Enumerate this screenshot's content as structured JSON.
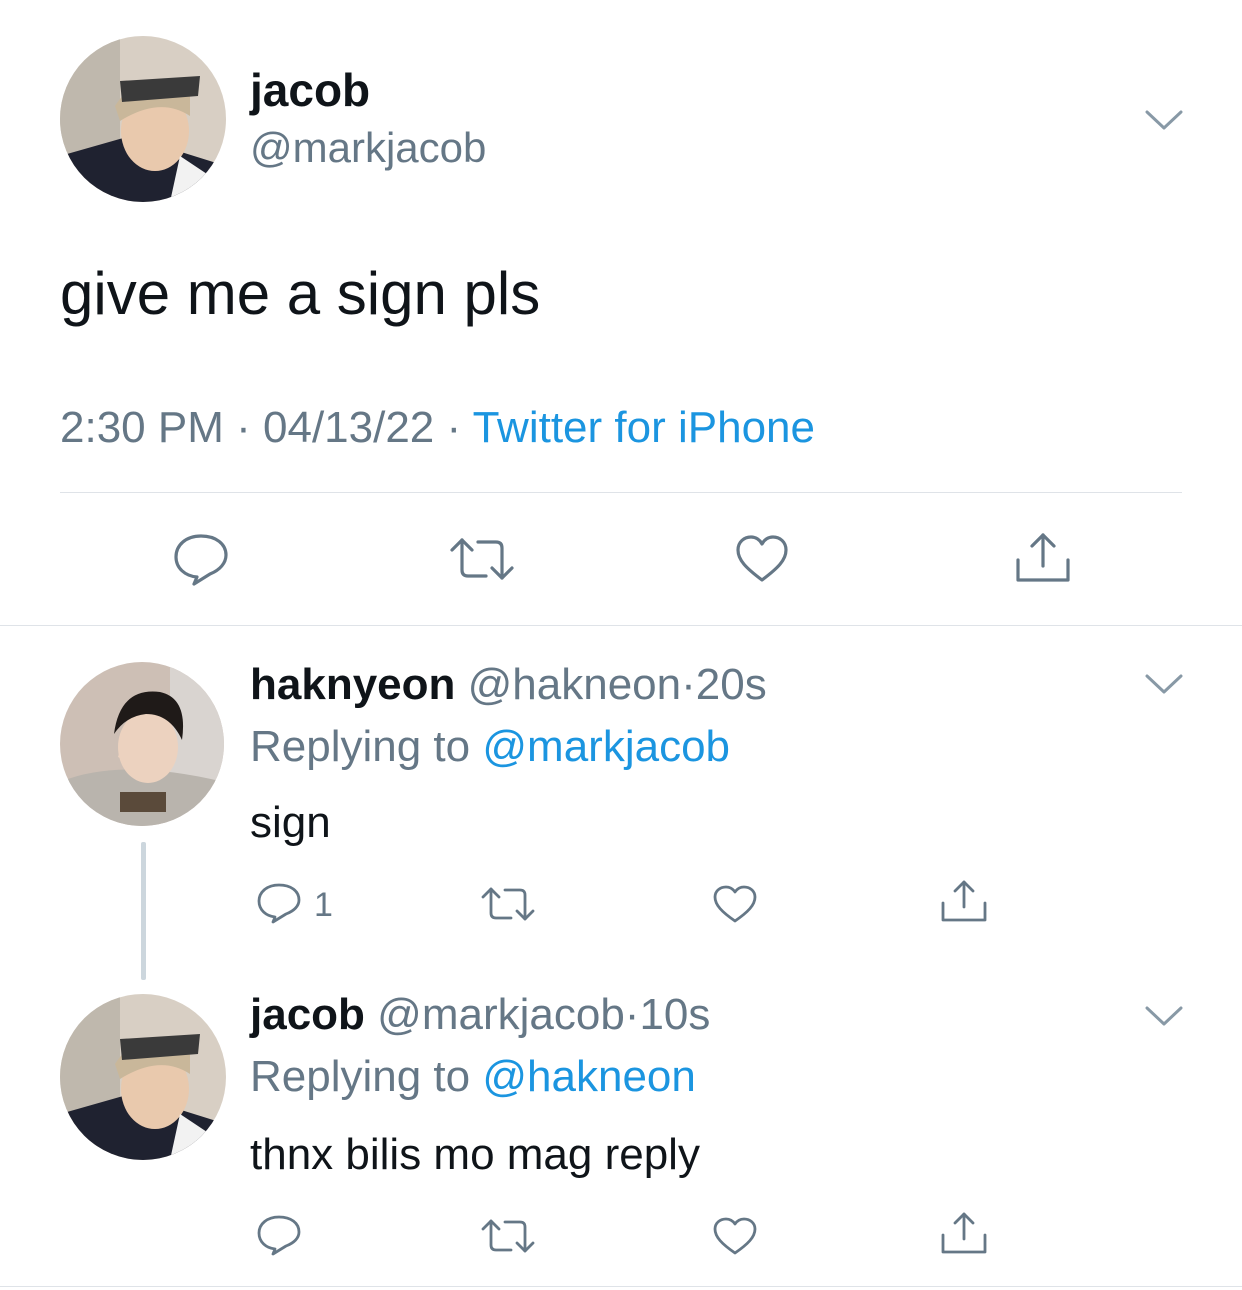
{
  "main_tweet": {
    "display_name": "jacob",
    "handle": "@markjacob",
    "text": "give me a sign pls",
    "time": "2:30 PM",
    "sep1": "·",
    "date": "04/13/22",
    "sep2": "·",
    "source": "Twitter for iPhone"
  },
  "replies": [
    {
      "display_name": "haknyeon",
      "handle": "@hakneon",
      "dot": "·",
      "age": "20s",
      "replying_prefix": "Replying to",
      "replying_to": "@markjacob",
      "text": "sign",
      "reply_count": "1"
    },
    {
      "display_name": "jacob",
      "handle": "@markjacob",
      "dot": "·",
      "age": "10s",
      "replying_prefix": "Replying to",
      "replying_to": "@hakneon",
      "text": "thnx bilis mo mag reply",
      "reply_count": ""
    }
  ],
  "icons": {
    "reply": "reply-bubble-icon",
    "retweet": "retweet-icon",
    "like": "heart-icon",
    "share": "share-icon",
    "more": "chevron-down-icon"
  },
  "colors": {
    "text": "#0f1419",
    "secondary": "#657786",
    "link": "#1b95e0",
    "divider": "#dfe3e8",
    "icon": "#657786"
  }
}
